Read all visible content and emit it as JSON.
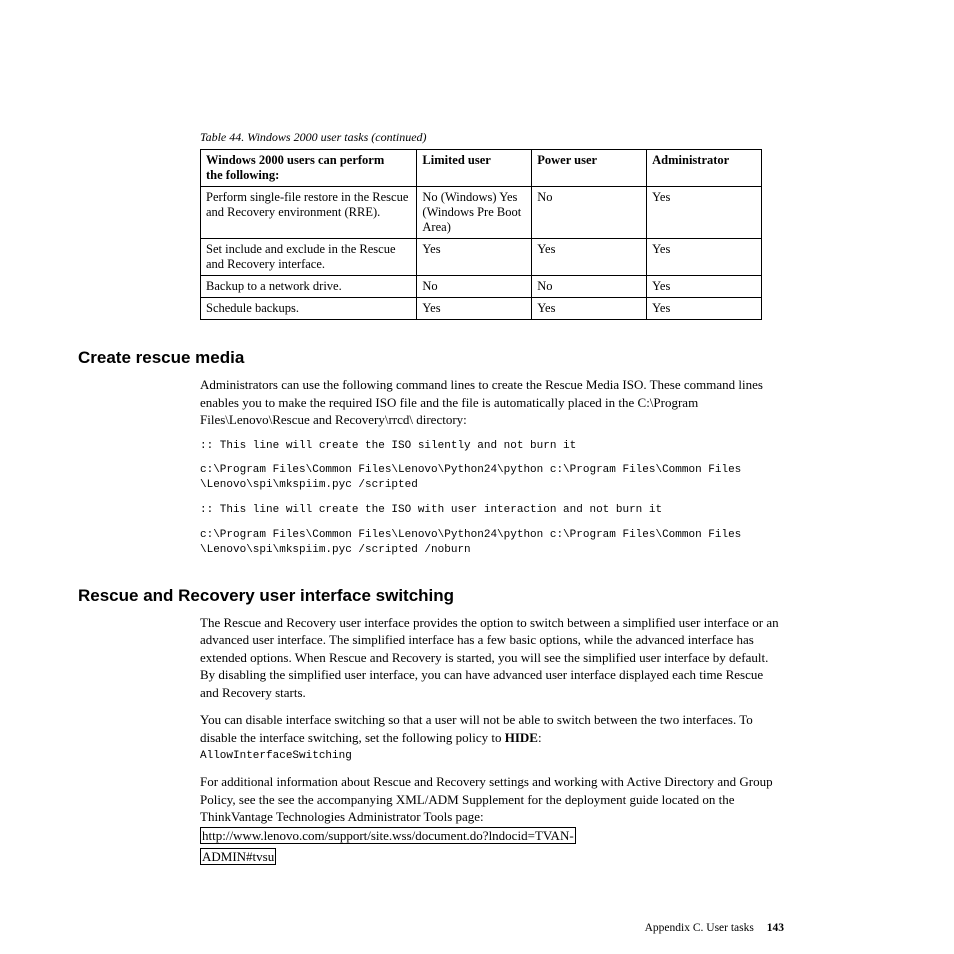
{
  "table": {
    "caption": "Table 44. Windows 2000 user tasks  (continued)",
    "headers": {
      "col1a": "Windows 2000 users can perform",
      "col1b": "the following:",
      "col2": "Limited user",
      "col3": "Power user",
      "col4": "Administrator"
    },
    "rows": [
      {
        "c1": "Perform single-file restore in the Rescue and Recovery environment (RRE).",
        "c2": "No (Windows) Yes (Windows Pre Boot Area)",
        "c3": "No",
        "c4": "Yes"
      },
      {
        "c1": "Set include and exclude in the Rescue and Recovery interface.",
        "c2": "Yes",
        "c3": "Yes",
        "c4": "Yes"
      },
      {
        "c1": "Backup to a network drive.",
        "c2": "No",
        "c3": "No",
        "c4": "Yes"
      },
      {
        "c1": "Schedule backups.",
        "c2": "Yes",
        "c3": "Yes",
        "c4": "Yes"
      }
    ]
  },
  "section1": {
    "heading": "Create rescue media",
    "p1": "Administrators can use the following command lines to create the Rescue Media ISO. These command lines enables you to make the required ISO file and the file is automatically placed in the C:\\Program Files\\Lenovo\\Rescue and Recovery\\rrcd\\ directory:",
    "code1": ":: This line will create the ISO silently and not burn it",
    "code2": "c:\\Program Files\\Common Files\\Lenovo\\Python24\\python c:\\Program Files\\Common Files\n\\Lenovo\\spi\\mkspiim.pyc /scripted",
    "code3": ":: This line will create the ISO with user interaction and not burn it",
    "code4": "c:\\Program Files\\Common Files\\Lenovo\\Python24\\python c:\\Program Files\\Common Files\n\\Lenovo\\spi\\mkspiim.pyc /scripted /noburn"
  },
  "section2": {
    "heading": "Rescue and Recovery user interface switching",
    "p1": "The Rescue and Recovery user interface provides the option to switch between a simplified user interface or an advanced user interface. The simplified interface has a few basic options, while the advanced interface has extended options. When Rescue and Recovery is started, you will see the simplified user interface by default. By disabling the simplified user interface, you can have advanced user interface displayed each time Rescue and Recovery starts.",
    "p2a": "You can disable interface switching so that a user will not be able to switch between the two interfaces. To disable the interface switching, set the following policy to ",
    "p2b": "HIDE",
    "p2c": ":",
    "code1": "AllowInterfaceSwitching",
    "p3": "For additional information about Rescue and Recovery settings and working with Active Directory and Group Policy, see the see the accompanying XML/ADM Supplement for the deployment guide located on the ThinkVantage Technologies Administrator Tools page:",
    "link1": "http://www.lenovo.com/support/site.wss/document.do?lndocid=TVAN-",
    "link2": "ADMIN#tvsu"
  },
  "footer": {
    "text": "Appendix C. User tasks",
    "page": "143"
  }
}
